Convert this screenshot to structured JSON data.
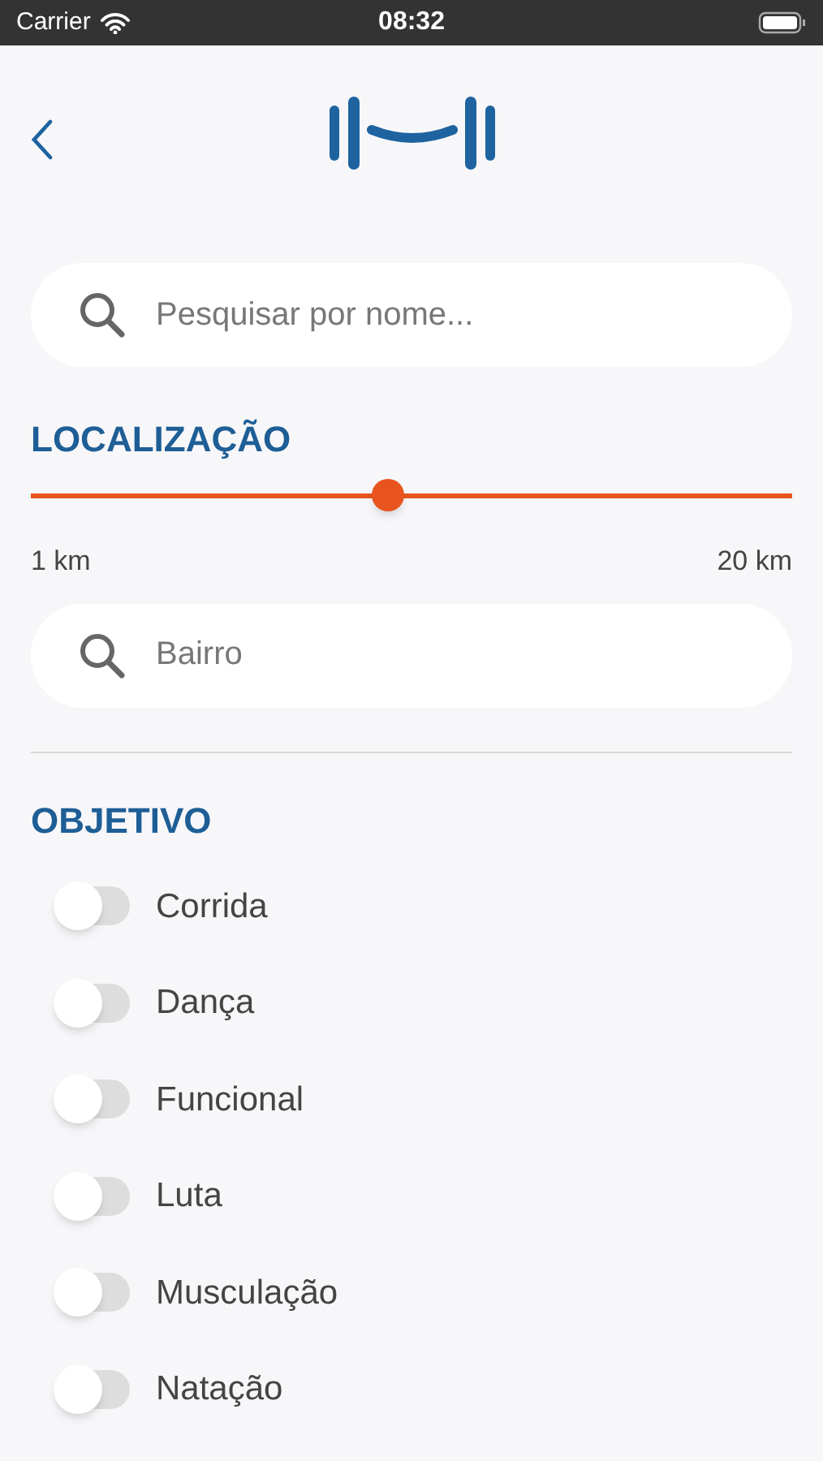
{
  "status_bar": {
    "carrier": "Carrier",
    "time": "08:32"
  },
  "search": {
    "placeholder": "Pesquisar por nome..."
  },
  "location": {
    "title": "LOCALIZAÇÃO",
    "distance": {
      "level": 0.47,
      "min_label": "1 km",
      "max_label": "20 km"
    },
    "neighborhood": {
      "placeholder": "Bairro"
    }
  },
  "objective": {
    "title": "OBJETIVO",
    "options": [
      {
        "label": "Corrida",
        "on": false
      },
      {
        "label": "Dança",
        "on": false
      },
      {
        "label": "Funcional",
        "on": false
      },
      {
        "label": "Luta",
        "on": false
      },
      {
        "label": "Musculação",
        "on": false
      },
      {
        "label": "Natação",
        "on": false
      }
    ]
  }
}
